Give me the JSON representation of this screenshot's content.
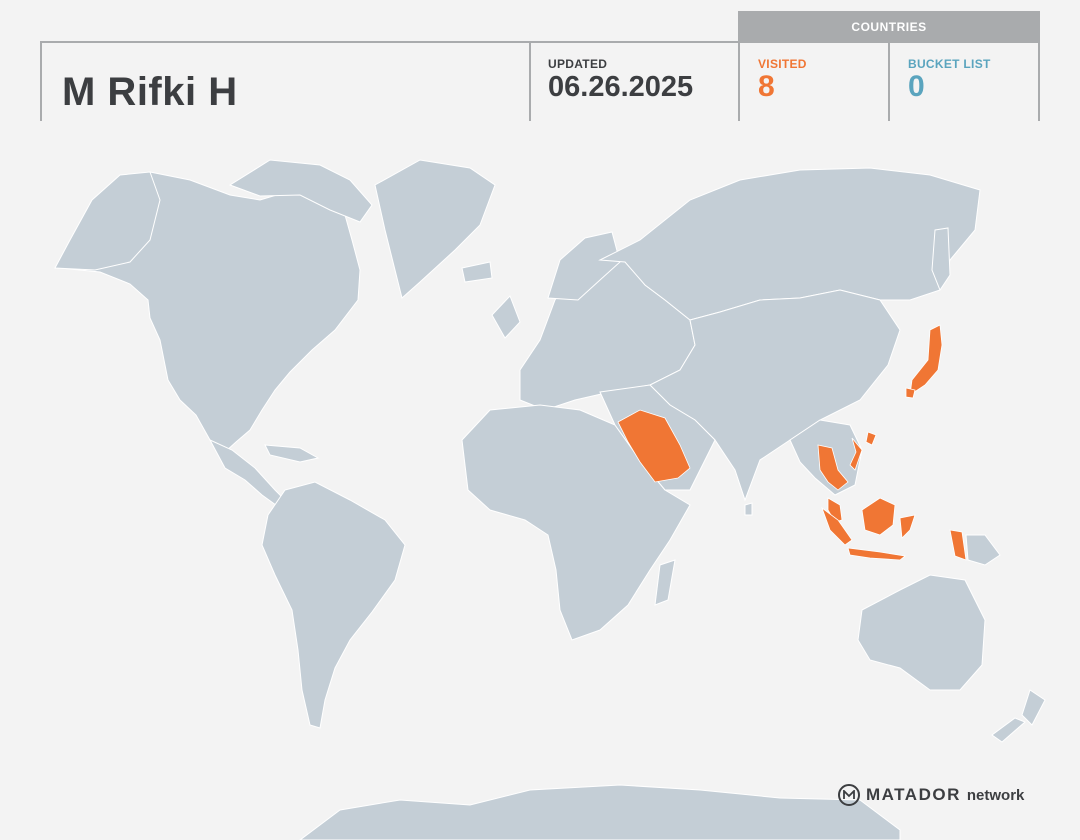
{
  "header": {
    "name": "M Rifki H",
    "updated_label": "UPDATED",
    "updated_value": "06.26.2025",
    "countries_label": "COUNTRIES",
    "visited_label": "VISITED",
    "visited_count": "8",
    "bucket_label": "BUCKET LIST",
    "bucket_count": "0"
  },
  "colors": {
    "visited": "#f07634",
    "bucket": "#5aa4be",
    "land": "#c4ced6",
    "border": "#ffffff",
    "header_bar": "#a9abad",
    "text_dark": "#3c3e41"
  },
  "map": {
    "visited_countries": [
      "Saudi Arabia",
      "Japan",
      "Thailand",
      "Vietnam",
      "Malaysia",
      "Singapore",
      "Indonesia",
      "Philippines"
    ]
  },
  "brand": {
    "logo_icon": "matador-m-icon",
    "word": "MATADOR",
    "suffix": "network"
  }
}
